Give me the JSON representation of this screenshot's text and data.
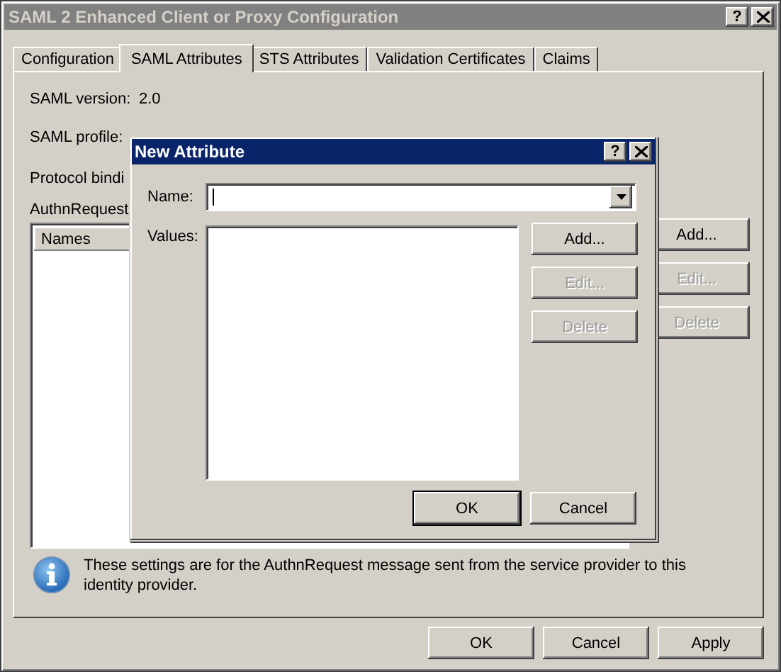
{
  "window": {
    "title": "SAML 2 Enhanced Client or Proxy Configuration",
    "help": "?"
  },
  "tabs": [
    {
      "label": "Configuration",
      "selected": false
    },
    {
      "label": "SAML Attributes",
      "selected": true
    },
    {
      "label": "STS Attributes",
      "selected": false
    },
    {
      "label": "Validation Certificates",
      "selected": false
    },
    {
      "label": "Claims",
      "selected": false
    }
  ],
  "fields": [
    {
      "label": "SAML version:",
      "value": "2.0"
    },
    {
      "label": "SAML profile:"
    },
    {
      "label": "Protocol bindi"
    }
  ],
  "section_label": "AuthnRequest",
  "names_list": {
    "columns": [
      "Names"
    ]
  },
  "side_buttons": [
    {
      "label": "Add...",
      "disabled": false
    },
    {
      "label": "Edit...",
      "disabled": true
    },
    {
      "label": "Delete",
      "disabled": true
    }
  ],
  "info": "These settings are for the AuthnRequest message sent from the service provider to this identity provider.",
  "footer_buttons": [
    {
      "label": "OK",
      "disabled": false
    },
    {
      "label": "Cancel",
      "disabled": false
    },
    {
      "label": "Apply",
      "disabled": false
    }
  ],
  "dialog": {
    "title": "New Attribute",
    "help": "?",
    "name_label": "Name:",
    "values_label": "Values:",
    "side_buttons": [
      {
        "label": "Add...",
        "disabled": false
      },
      {
        "label": "Edit...",
        "disabled": true
      },
      {
        "label": "Delete",
        "disabled": true
      }
    ],
    "footer_buttons": [
      {
        "label": "OK",
        "default": true
      },
      {
        "label": "Cancel",
        "default": false
      }
    ]
  }
}
